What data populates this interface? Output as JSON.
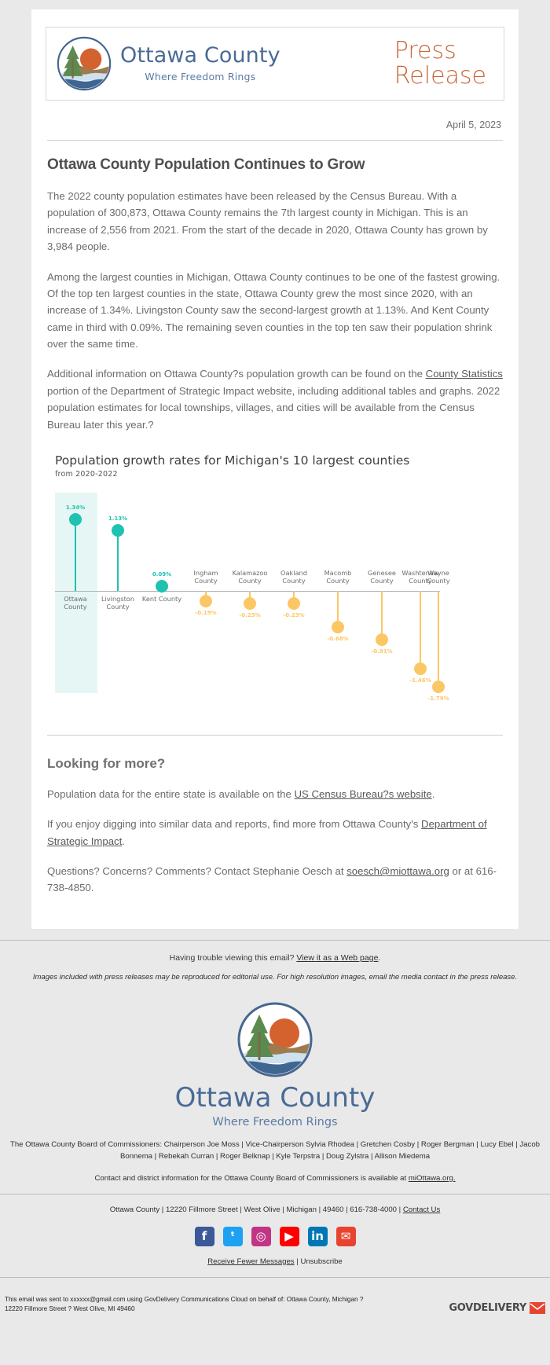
{
  "header": {
    "logo_title": "Ottawa County",
    "logo_tagline": "Where Freedom Rings",
    "press_line1": "Press",
    "press_line2": "Release"
  },
  "date": "April 5, 2023",
  "article": {
    "headline": "Ottawa County Population Continues to Grow",
    "p1": "The 2022 county population estimates have been released by the Census Bureau. With a population of 300,873, Ottawa County remains the 7th largest county in Michigan. This is an increase of 2,556 from 2021. From the start of the decade in 2020, Ottawa County has grown by 3,984 people.",
    "p2": "Among the largest counties in Michigan, Ottawa County continues to be one of the fastest growing. Of the top ten largest counties in the state, Ottawa County grew the most since 2020, with an increase of 1.34%. Livingston County saw the second-largest growth at 1.13%. And Kent County came in third with 0.09%. The remaining seven counties in the top ten saw their population shrink over the same time.",
    "p3_a": "Additional information on Ottawa County?s population growth can be found on the ",
    "p3_link": "County Statistics",
    "p3_b": " portion of the Department of Strategic Impact website, including additional tables and graphs. 2022 population estimates for local townships, villages, and cities will be available from the Census Bureau later this year.?"
  },
  "chart_data": {
    "type": "bar",
    "title": "Population growth rates for Michigan's 10 largest counties",
    "subtitle": "from 2020-2022",
    "xlabel": "",
    "ylabel": "",
    "ylim": [
      -2.0,
      1.6
    ],
    "grid": false,
    "legend": "none",
    "highlight_category": "Ottawa County",
    "positive_color": "#1ec2b0",
    "negative_color": "#fbc765",
    "categories": [
      "Ottawa County",
      "Livingston County",
      "Kent County",
      "Ingham County",
      "Kalamazoo County",
      "Oakland County",
      "Macomb County",
      "Genesee County",
      "Washtenaw County",
      "Wayne County"
    ],
    "values": [
      1.34,
      1.13,
      0.09,
      -0.19,
      -0.23,
      -0.23,
      -0.68,
      -0.91,
      -1.46,
      -1.79
    ],
    "value_labels": [
      "1.34%",
      "1.13%",
      "0.09%",
      "-0.19%",
      "-0.23%",
      "-0.23%",
      "-0.68%",
      "-0.91%",
      "-1.46%",
      "-1.79%"
    ]
  },
  "more": {
    "heading": "Looking for more?",
    "p1_a": "Population data for the entire state is available on the ",
    "p1_link": "US Census Bureau?s website",
    "p1_b": ".",
    "p2_a": "If you enjoy digging into similar data and reports, find more from Ottawa County's ",
    "p2_link": "Department of Strategic Impact",
    "p2_b": ".",
    "p3_a": "Questions? Concerns? Comments? Contact Stephanie Oesch at ",
    "p3_link": "soesch@miottawa.org",
    "p3_b": " or at 616-738-4850."
  },
  "footer": {
    "trouble_a": "Having trouble viewing this email? ",
    "trouble_link": "View it as a Web page",
    "trouble_b": ".",
    "reproduce_note": "Images included with press releases may be reproduced for editorial use. For high resolution images, email the media contact in the press release.",
    "logo_title": "Ottawa County",
    "logo_tagline": "Where Freedom Rings",
    "board": "The Ottawa County Board of Commissioners: Chairperson Joe Moss | Vice-Chairperson Sylvia Rhodea | Gretchen Cosby | Roger Bergman | Lucy Ebel | Jacob Bonnema | Rebekah Curran | Roger Belknap | Kyle Terpstra | Doug Zylstra | Allison Miedema",
    "contact_a": "Contact and district information for the Ottawa County Board of Commissioners is available at ",
    "contact_link": "miOttawa.org.",
    "address": "Ottawa County | 12220 Fillmore Street | West Olive | Michigan | 49460 | 616-738-4000 | ",
    "address_link": "Contact Us",
    "social": [
      {
        "name": "facebook-icon",
        "glyph": "f",
        "color": "#3b5998"
      },
      {
        "name": "twitter-icon",
        "glyph": "ᵗ",
        "color": "#1da1f2"
      },
      {
        "name": "instagram-icon",
        "glyph": "◎",
        "color": "#c13584"
      },
      {
        "name": "youtube-icon",
        "glyph": "▶",
        "color": "#ff0000"
      },
      {
        "name": "linkedin-icon",
        "glyph": "in",
        "color": "#0077b5"
      },
      {
        "name": "email-icon",
        "glyph": "✉",
        "color": "#e8432f"
      }
    ],
    "fewer_link": "Receive Fewer Messages",
    "fewer_sep": " | ",
    "unsubscribe": "Unsubscribe",
    "sent_line1": "This email was sent to xxxxxx@gmail.com using GovDelivery Communications Cloud on behalf of: Ottawa County, Michigan ?",
    "sent_line2": "12220 Fillmore Street ? West Olive, MI 49460",
    "govdelivery_brand": "GOVDELIVERY"
  }
}
